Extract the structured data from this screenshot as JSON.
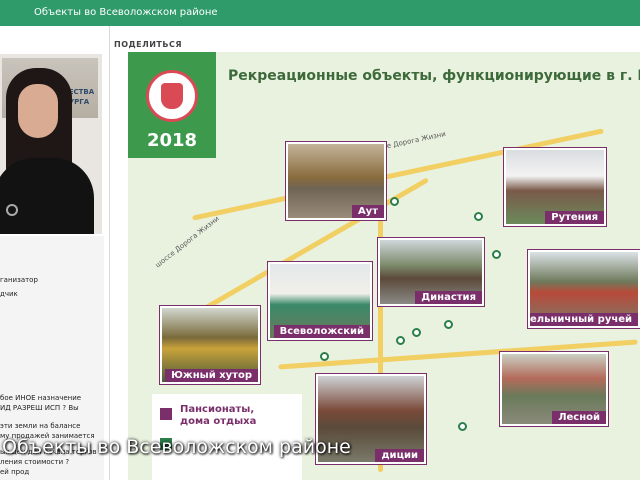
{
  "topbar": {
    "title": "Объекты во Всеволожском районе"
  },
  "video": {
    "poster_line1": "ФОНД ИМУЩЕСТВА",
    "poster_line2": "НКТ-ПЕТЕРБУРГА"
  },
  "chat": {
    "lines": [
      "ганизатор",
      "дчик",
      "бое ИНОЕ назначение",
      "ИД РАЗРЕШ ИСП ? Вы",
      "эти земли на балансе",
      "му продажей занимается",
      "ых цен для начала торгов",
      "ления стоимости ?",
      "ей прод"
    ]
  },
  "share": {
    "label": "ПОДЕЛИТЬСЯ"
  },
  "slide": {
    "year": "2018",
    "title": "Рекреационные объекты, функционирующие в г. Всев",
    "roads": {
      "r1": "шоссе Дорога Жизни",
      "r2": "шоссе Дорога Жизни"
    },
    "photos": [
      {
        "caption": "Аут"
      },
      {
        "caption": "Рутения"
      },
      {
        "caption": "Династия"
      },
      {
        "caption": "Мельничный ручей"
      },
      {
        "caption": "Всеволожский"
      },
      {
        "caption": "Южный хутор"
      },
      {
        "caption": "Лесной"
      },
      {
        "caption": "диции"
      }
    ],
    "legend": [
      {
        "text": "Пансионаты,",
        "text2": "дома отдыха",
        "color": "#7a2f6a"
      },
      {
        "text": "",
        "text2": "",
        "color": "#2a7f4a"
      }
    ]
  },
  "subtitle": {
    "text": "Объекты во Всеволожском районе"
  },
  "colors": {
    "topbar": "#2f9a6a",
    "accent": "#7a2f6a",
    "logo_bg": "#3d9a4d"
  }
}
